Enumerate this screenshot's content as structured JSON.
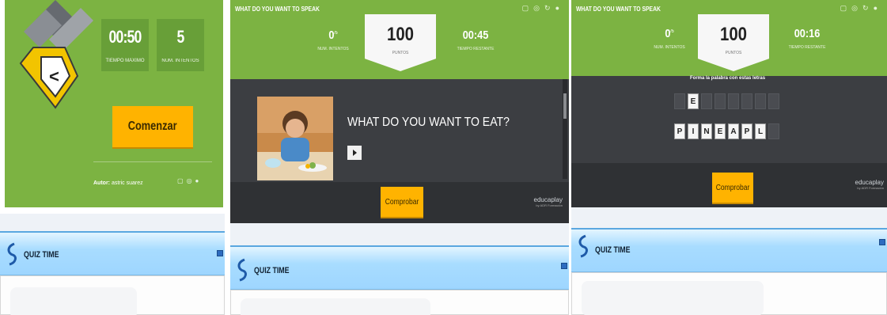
{
  "panel1": {
    "time_max": {
      "value": "00:50",
      "label": "TIEMPO MÁXIMO"
    },
    "attempts": {
      "value": "5",
      "label": "NUM. INTENTOS"
    },
    "start_label": "Comenzar",
    "author_label": "Autor:",
    "author_name": "astric suarez",
    "quiz_title": "QUIZ TIME"
  },
  "panel2": {
    "title": "WHAT DO YOU WANT TO SPEAK",
    "attempts": {
      "value": "0",
      "of": "/5",
      "label": "NUM. INTENTOS"
    },
    "points": {
      "value": "100",
      "label": "PUNTOS"
    },
    "time": {
      "value": "00:45",
      "label": "TIEMPO RESTANTE"
    },
    "question": "WHAT DO YOU WANT TO EAT?",
    "check_label": "Comprobar",
    "brand": "educaplay",
    "brand_sub": "by ADR Formación",
    "quiz_title": "QUIZ TIME"
  },
  "panel3": {
    "title": "WHAT DO YOU WANT TO SPEAK",
    "attempts": {
      "value": "0",
      "of": "/5",
      "label": "NUM. INTENTOS"
    },
    "points": {
      "value": "100",
      "label": "PUNTOS"
    },
    "time": {
      "value": "00:16",
      "label": "TIEMPO RESTANTE"
    },
    "instruction": "Forma la palabra con estas letras",
    "answer_tiles": [
      "",
      "E",
      "",
      "",
      "",
      "",
      "",
      ""
    ],
    "letter_tiles": [
      "P",
      "I",
      "N",
      "E",
      "A",
      "P",
      "L",
      ""
    ],
    "check_label": "Comprobar",
    "brand": "educaplay",
    "brand_sub": "by ADR Formación",
    "quiz_title": "QUIZ TIME"
  },
  "colors": {
    "green": "#7cb342",
    "orange": "#ffb300",
    "dark": "#3c3e42",
    "quiz_blue": "#9ed6ff"
  },
  "icons": [
    "fullscreen-icon",
    "embed-icon",
    "refresh-icon",
    "info-icon",
    "quiz-hook-icon",
    "play-icon",
    "collapse-icon"
  ]
}
